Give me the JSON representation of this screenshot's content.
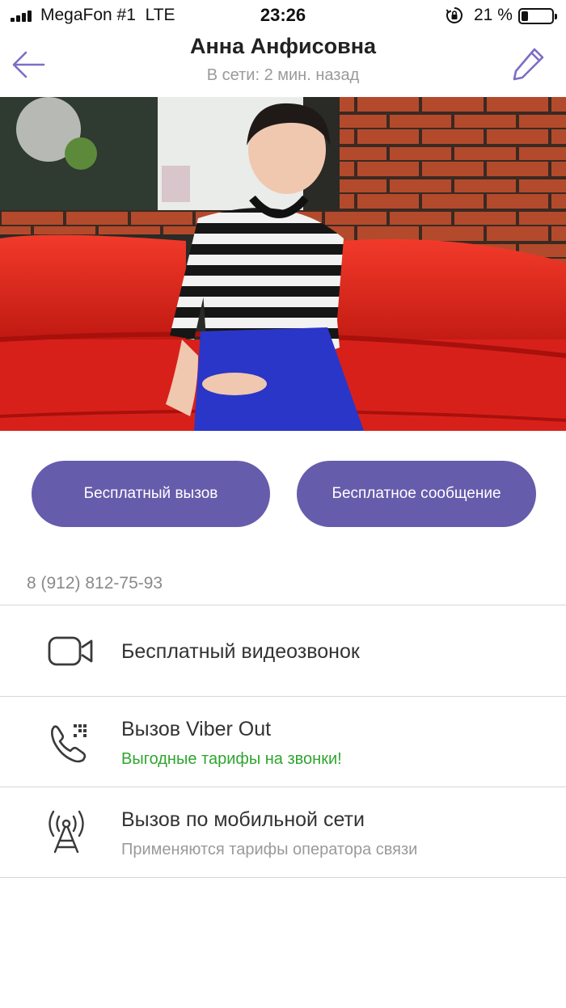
{
  "status_bar": {
    "carrier": "MegaFon #1",
    "network": "LTE",
    "time": "23:26",
    "battery_percent": "21 %",
    "battery_level": 0.21
  },
  "header": {
    "contact_name": "Анна Анфисовна",
    "presence": "В сети: 2 мин. назад",
    "back_icon": "arrow-left-icon",
    "edit_icon": "pencil-icon"
  },
  "actions": {
    "free_call": "Бесплатный вызов",
    "free_message": "Бесплатное сообщение"
  },
  "phone_number": "8 (912) 812-75-93",
  "options": [
    {
      "icon": "video-camera-icon",
      "title": "Бесплатный видеозвонок",
      "subtitle": ""
    },
    {
      "icon": "viber-out-phone-icon",
      "title": "Вызов Viber Out",
      "subtitle": "Выгодные тарифы на звонки!"
    },
    {
      "icon": "cell-tower-icon",
      "title": "Вызов по мобильной сети",
      "subtitle": "Применяются тарифы оператора связи"
    }
  ],
  "colors": {
    "accent": "#665cac",
    "promo_green": "#2fa52f",
    "muted": "#9a9a9a"
  }
}
